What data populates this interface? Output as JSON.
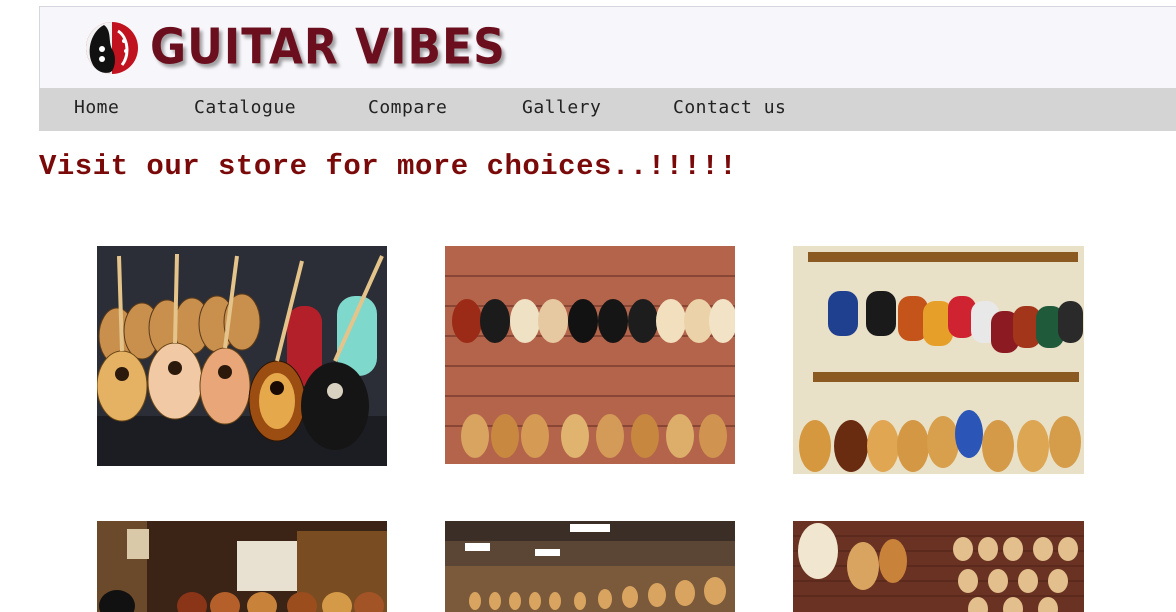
{
  "brand": {
    "name": "GUITAR VIBES"
  },
  "nav": {
    "items": [
      {
        "label": "Home"
      },
      {
        "label": "Catalogue"
      },
      {
        "label": "Compare"
      },
      {
        "label": "Gallery"
      },
      {
        "label": "Contact us"
      }
    ]
  },
  "main": {
    "headline": "Visit our store for more choices..!!!!!"
  },
  "gallery": {
    "photos": [
      {
        "subject": "acoustic guitars on floor stands"
      },
      {
        "subject": "acoustic guitars on wall hooks"
      },
      {
        "subject": "electric guitars on wall rack"
      },
      {
        "subject": "guitars in store interior"
      },
      {
        "subject": "guitar store showroom"
      },
      {
        "subject": "acoustic guitars on brick wall"
      }
    ]
  },
  "colors": {
    "brand_maroon": "#6b0f1e",
    "headline_red": "#7a0a0a",
    "nav_bg": "#d4d4d4",
    "header_bg": "#f7f7fb"
  }
}
